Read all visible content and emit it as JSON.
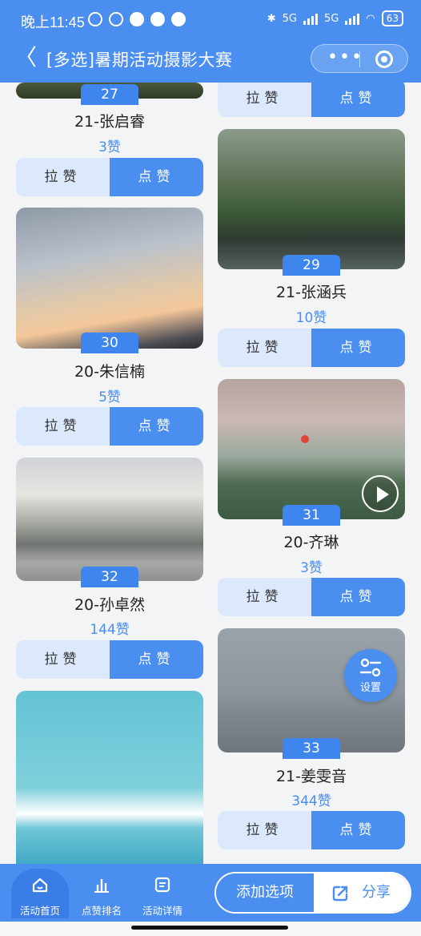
{
  "status_bar": {
    "time": "晚上11:45",
    "net1": "5G",
    "net2": "5G",
    "battery": "63"
  },
  "nav": {
    "title": "[多选]暑期活动摄影大赛",
    "more_icon": "more-dots-icon",
    "close_icon": "target-icon"
  },
  "buttons": {
    "pull": "拉赞",
    "like": "点赞"
  },
  "cards": [
    {
      "num": "27",
      "name": "21-张启睿",
      "votes": "3赞"
    },
    {
      "num": "30",
      "name": "20-朱信楠",
      "votes": "5赞"
    },
    {
      "num": "32",
      "name": "20-孙卓然",
      "votes": "144赞"
    },
    {
      "num": "29",
      "name": "21-张涵兵",
      "votes": "10赞"
    },
    {
      "num": "31",
      "name": "20-齐琳",
      "votes": "3赞"
    },
    {
      "num": "33",
      "name": "21-姜雯音",
      "votes": "344赞"
    }
  ],
  "settings": {
    "label": "设置"
  },
  "tabs": [
    {
      "label": "活动首页",
      "icon": "home-icon"
    },
    {
      "label": "点赞排名",
      "icon": "bar-chart-icon"
    },
    {
      "label": "活动详情",
      "icon": "document-icon"
    }
  ],
  "actions": {
    "add": "添加选项",
    "share": "分享"
  },
  "colors": {
    "primary": "#4a8ef0",
    "light": "#dce8fb"
  }
}
